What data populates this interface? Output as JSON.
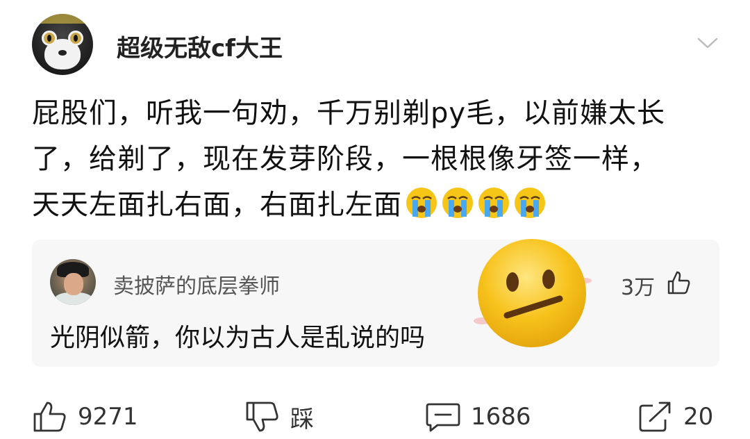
{
  "post": {
    "username": "超级无敌cf大王",
    "text_lines": [
      "屁股们，听我一句劝，千万别剃py毛，以前嫌太长",
      "了，给剃了，现在发芽阶段，一根根像牙签一样，",
      "天天左面扎右面，右面扎左面"
    ],
    "trailing_emojis": [
      "loudly-crying-face",
      "loudly-crying-face",
      "loudly-crying-face",
      "loudly-crying-face"
    ]
  },
  "comment": {
    "username": "卖披萨的底层拳师",
    "text": "光阴似箭，你以为古人是乱说的吗",
    "likes": "3万"
  },
  "sticker": {
    "icon": "neutral-face-emoji"
  },
  "actions": {
    "like_count": "9271",
    "dislike_label": "踩",
    "comment_count": "1686",
    "share_count": "20"
  },
  "colors": {
    "text": "#111111",
    "secondary": "#555555",
    "card_bg": "#f7f7f7",
    "emoji_yellow": "#f5c518"
  }
}
